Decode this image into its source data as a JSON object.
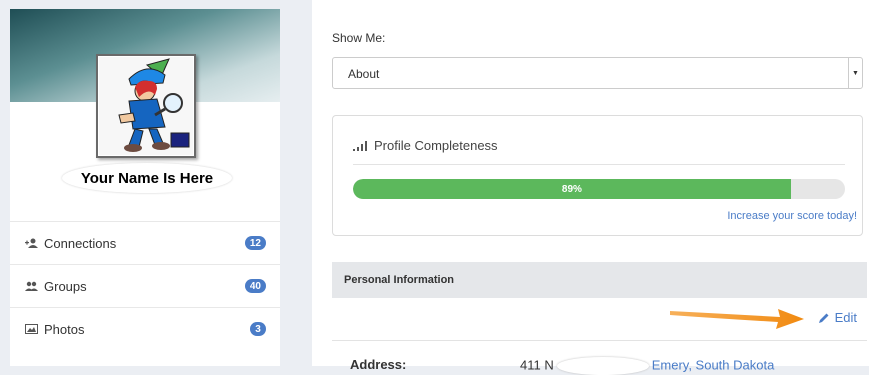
{
  "profile": {
    "name": "Your Name Is Here"
  },
  "sidebar": {
    "items": [
      {
        "label": "Connections",
        "count": "12",
        "icon": "connections-icon"
      },
      {
        "label": "Groups",
        "count": "40",
        "icon": "groups-icon"
      },
      {
        "label": "Photos",
        "count": "3",
        "icon": "photos-icon"
      }
    ]
  },
  "main": {
    "show_me_label": "Show Me:",
    "show_me_value": "About",
    "profile_completeness": {
      "title": "Profile Completeness",
      "percent": 89,
      "percent_label": "89%",
      "increase_link": "Increase your score today!"
    },
    "personal_info": {
      "header": "Personal Information",
      "edit_label": "Edit",
      "address_label": "Address:",
      "address_prefix": "411 N",
      "address_city": "Emery, South Dakota"
    }
  },
  "colors": {
    "accent": "#4a7cc7",
    "progress": "#5cb85c",
    "annotation_arrow": "#f5901e"
  }
}
